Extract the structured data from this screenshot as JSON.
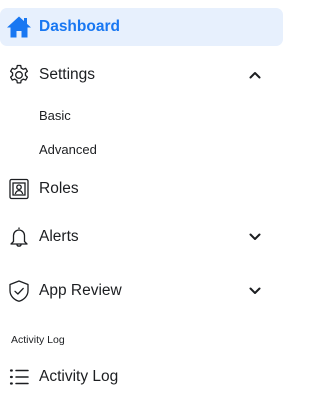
{
  "sidebar": {
    "dashboard": {
      "label": "Dashboard",
      "icon": "home-icon"
    },
    "settings": {
      "label": "Settings",
      "icon": "gear-icon",
      "expanded": true,
      "sub_items": [
        {
          "label": "Basic"
        },
        {
          "label": "Advanced"
        }
      ]
    },
    "roles": {
      "label": "Roles",
      "icon": "id-badge-icon"
    },
    "alerts": {
      "label": "Alerts",
      "icon": "bell-icon",
      "expanded": false
    },
    "app_review": {
      "label": "App Review",
      "icon": "shield-check-icon",
      "expanded": false
    },
    "activity_section_header": "Activity Log",
    "activity_log": {
      "label": "Activity Log",
      "icon": "list-icon"
    }
  },
  "colors": {
    "accent": "#1877f2",
    "active_background": "#e7f0fd",
    "text": "#1c1e21"
  }
}
